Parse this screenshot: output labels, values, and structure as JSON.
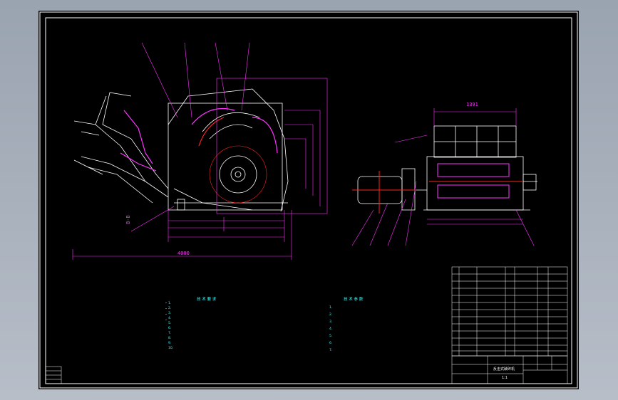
{
  "drawing": {
    "dim_width_top": "1391",
    "dim_total_length": "4000",
    "section_label": "B-B"
  },
  "notes_left": {
    "title": "技 术 要 求",
    "lines": [
      "1.",
      "2.",
      "3.",
      "4.",
      "5.",
      "6.",
      "7.",
      "8.",
      "9.",
      "10."
    ]
  },
  "notes_right": {
    "title": "技 术 参 数",
    "lines": [
      "1.",
      "2.",
      "3.",
      "4.",
      "5.",
      "6.",
      "7."
    ]
  },
  "title_block": {
    "name": "反击式破碎机",
    "scale": "1:1"
  },
  "colors": {
    "sheet_bg": "#000000",
    "frame": "#ffffff",
    "part_lines": "#ffffff",
    "dimension": "#ff33ff",
    "notes": "#33ffff",
    "accent_red": "#ff2222"
  }
}
